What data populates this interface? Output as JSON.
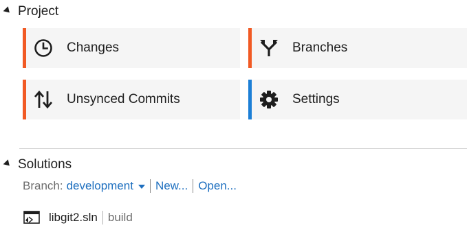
{
  "project": {
    "header": "Project",
    "tiles": [
      {
        "label": "Changes",
        "icon": "clock-icon",
        "accent": "#f15a24"
      },
      {
        "label": "Branches",
        "icon": "branch-icon",
        "accent": "#f15a24"
      },
      {
        "label": "Unsynced Commits",
        "icon": "sync-arrows-icon",
        "accent": "#f15a24"
      },
      {
        "label": "Settings",
        "icon": "gear-icon",
        "accent": "#1c7fd6"
      }
    ]
  },
  "solutions": {
    "header": "Solutions",
    "branch_label": "Branch:",
    "branch_value": "development",
    "new_link": "New...",
    "open_link": "Open...",
    "solution_file": "libgit2.sln",
    "solution_config": "build"
  },
  "colors": {
    "orange_accent": "#f15a24",
    "blue_accent": "#1c7fd6",
    "link": "#1e6fbf"
  }
}
